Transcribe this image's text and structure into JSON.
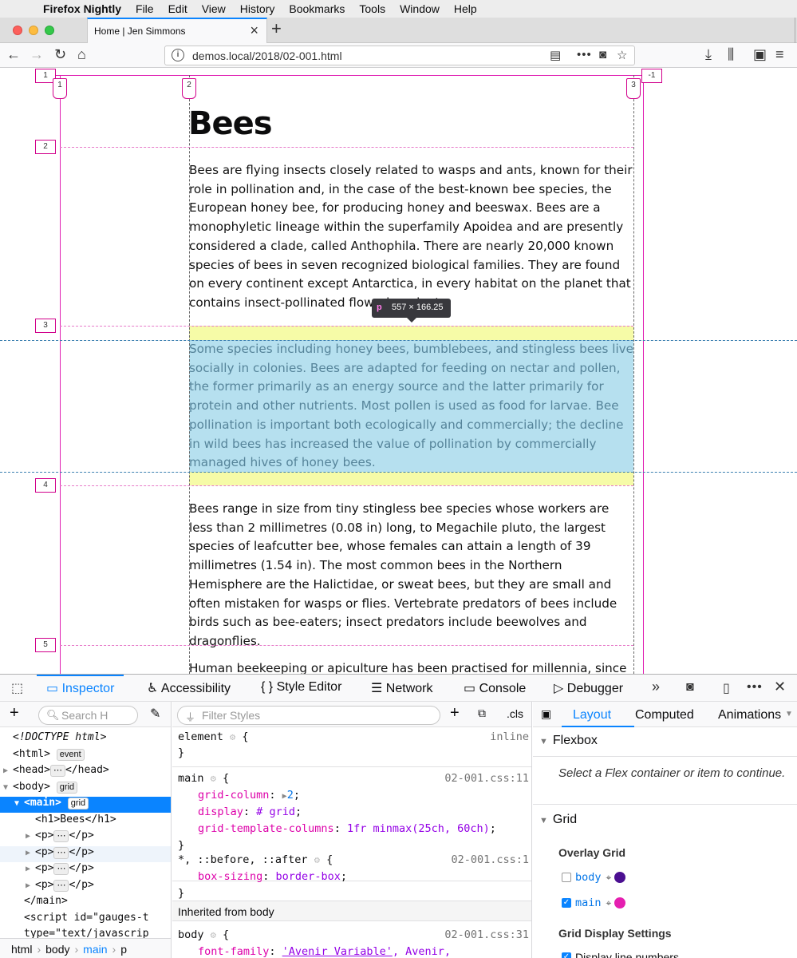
{
  "menubar": {
    "app": "Firefox Nightly",
    "items": [
      "File",
      "Edit",
      "View",
      "History",
      "Bookmarks",
      "Tools",
      "Window",
      "Help"
    ]
  },
  "tab": {
    "title": "Home | Jen Simmons"
  },
  "url": "demos.local/2018/02-001.html",
  "page": {
    "heading": "Bees",
    "paragraphs": [
      "Bees are flying insects closely related to wasps and ants, known for their role in pollination and, in the case of the best-known bee species, the European honey bee, for producing honey and beeswax. Bees are a monophyletic lineage within the superfamily Apoidea and are presently considered a clade, called Anthophila. There are nearly 20,000 known species of bees in seven recognized biological families. They are found on every continent except Antarctica, in every habitat on the planet that contains insect-pollinated flowering plants.",
      "Some species including honey bees, bumblebees, and stingless bees live socially in colonies. Bees are adapted for feeding on nectar and pollen, the former primarily as an energy source and the latter primarily for protein and other nutrients. Most pollen is used as food for larvae. Bee pollination is important both ecologically and commercially; the decline in wild bees has increased the value of pollination by commercially managed hives of honey bees.",
      "Bees range in size from tiny stingless bee species whose workers are less than 2 millimetres (0.08 in) long, to Megachile pluto, the largest species of leafcutter bee, whose females can attain a length of 39 millimetres (1.54 in). The most common bees in the Northern Hemisphere are the Halictidae, or sweat bees, but they are small and often mistaken for wasps or flies. Vertebrate predators of bees include birds such as bee-eaters; insect predators include beewolves and dragonflies.",
      "Human beekeeping or apiculture has been practised for millennia, since at"
    ],
    "tooltip": {
      "tag": "p",
      "size": "557 × 166.25"
    },
    "grid_row_labels": [
      "1",
      "2",
      "3",
      "4",
      "5"
    ],
    "grid_col_labels": [
      "1",
      "2",
      "3"
    ],
    "grid_extra_labels": [
      "-1"
    ]
  },
  "devtools": {
    "tabs": [
      "Inspector",
      "Accessibility",
      "Style Editor",
      "Network",
      "Console",
      "Debugger"
    ],
    "more": "»",
    "markup_search_placeholder": "Search H",
    "markup": [
      {
        "text": "<!DOCTYPE html>",
        "indent": 0,
        "italic": true
      },
      {
        "text": "<html>",
        "indent": 0,
        "pill": "event"
      },
      {
        "text": "<head>",
        "after": "</head>",
        "indent": 0,
        "twisty": "▶",
        "dots": true
      },
      {
        "text": "<body>",
        "indent": 0,
        "twisty": "▼",
        "pill": "grid"
      },
      {
        "text": "<main>",
        "indent": 1,
        "twisty": "▼",
        "pill": "grid",
        "selected": true
      },
      {
        "text": "<h1>Bees</h1>",
        "indent": 2
      },
      {
        "text": "<p>",
        "after": "</p>",
        "indent": 2,
        "twisty": "▶",
        "dots": true
      },
      {
        "text": "<p>",
        "after": "</p>",
        "indent": 2,
        "twisty": "▶",
        "dots": true,
        "hover": true
      },
      {
        "text": "<p>",
        "after": "</p>",
        "indent": 2,
        "twisty": "▶",
        "dots": true
      },
      {
        "text": "<p>",
        "after": "</p>",
        "indent": 2,
        "twisty": "▶",
        "dots": true
      },
      {
        "text": "</main>",
        "indent": 1
      },
      {
        "text": "<script id=\"gauges-t",
        "indent": 1
      },
      {
        "text": "type=\"text/javascrip",
        "indent": 1
      }
    ],
    "breadcrumbs": [
      "html",
      "body",
      "main",
      "p"
    ],
    "filter_placeholder": "Filter Styles",
    "cls_label": ".cls",
    "rules": {
      "element": {
        "selector": "element",
        "source": "inline"
      },
      "main": {
        "selector": "main",
        "source": "02-001.css:11",
        "decls": [
          {
            "prop": "grid-column",
            "val": "2"
          },
          {
            "prop": "display",
            "val": "grid"
          },
          {
            "prop": "grid-template-columns",
            "val": "1fr minmax(25ch, 60ch)"
          }
        ]
      },
      "universal": {
        "selector": "*, ::before, ::after",
        "source": "02-001.css:1",
        "decls": [
          {
            "prop": "box-sizing",
            "val": "border-box"
          }
        ]
      },
      "inherited_header": "Inherited from body",
      "body": {
        "selector": "body",
        "source": "02-001.css:31",
        "decls": [
          {
            "prop": "font-family",
            "val_link": "'Avenir Variable'",
            "val_rest": ", Avenir,"
          }
        ]
      }
    },
    "layout_tabs": [
      "Layout",
      "Computed",
      "Animations"
    ],
    "layout": {
      "flexbox_title": "Flexbox",
      "flexbox_msg": "Select a Flex container or item to continue.",
      "grid_title": "Grid",
      "overlay_title": "Overlay Grid",
      "overlays": [
        {
          "label": "body",
          "checked": false,
          "color": "#4b0f91"
        },
        {
          "label": "main",
          "checked": true,
          "color": "#e51fb0"
        }
      ],
      "display_settings_title": "Grid Display Settings",
      "display_line_numbers": "Display line numbers"
    },
    "colors": {
      "accent": "#0a84ff",
      "grid_overlay": "#e01fb3",
      "highlight_yellow": "#f6fba7",
      "highlight_blue": "#b6e0ef"
    }
  }
}
